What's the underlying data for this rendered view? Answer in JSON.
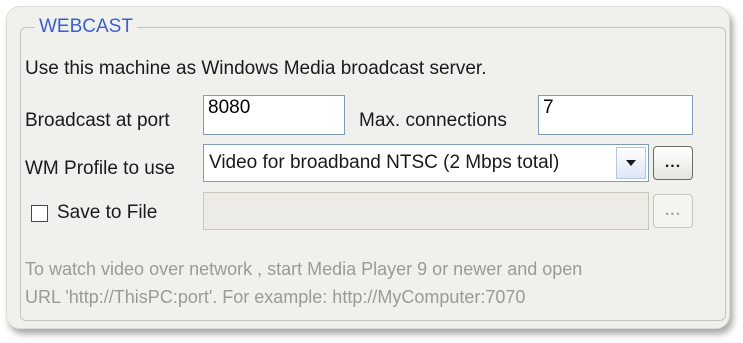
{
  "group": {
    "title": "WEBCAST",
    "description": "Use this machine as Windows Media broadcast server."
  },
  "port": {
    "label": "Broadcast at port",
    "value": "8080"
  },
  "connections": {
    "label": "Max. connections",
    "value": "7"
  },
  "profile": {
    "label": "WM Profile to use",
    "selected": "Video for broadband NTSC (2 Mbps total)",
    "browse_label": "..."
  },
  "save": {
    "label": "Save to File",
    "checked": false,
    "path_value": "",
    "browse_label": "..."
  },
  "hint": {
    "line1": "To watch video over network , start Media Player 9 or newer and open",
    "line2": "URL 'http://ThisPC:port'. For example: http://MyComputer:7070"
  },
  "colors": {
    "title": "#3a5fd0",
    "hint": "#9a9a96",
    "panel": "#f0f0ed"
  }
}
